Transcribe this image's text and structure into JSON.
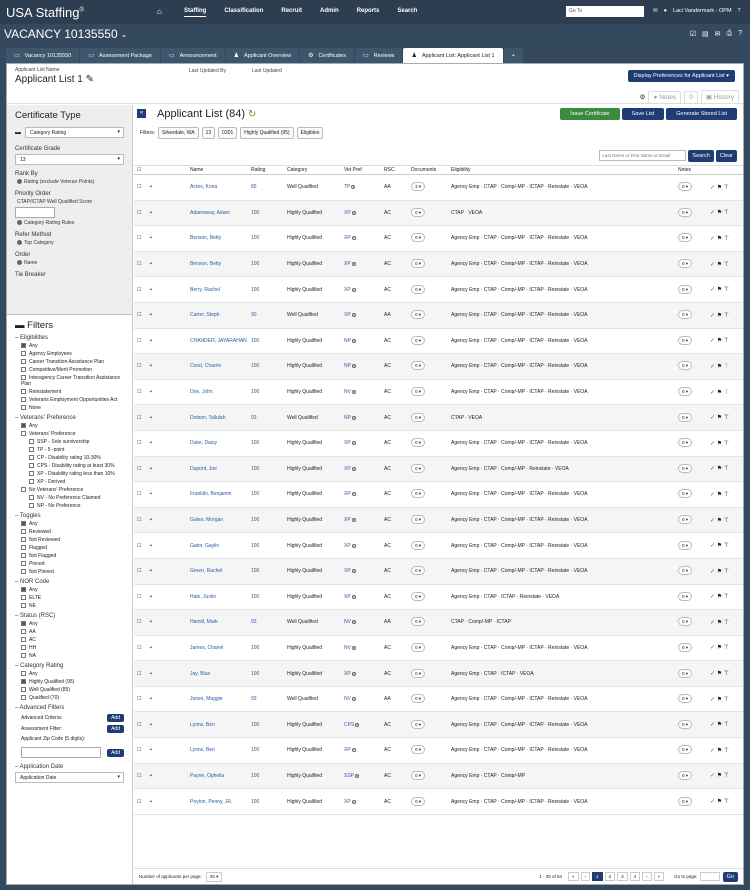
{
  "app": {
    "logo": "USA Staffing",
    "logo_mark": "®",
    "nav": [
      "Staffing",
      "Classification",
      "Recruit",
      "Admin",
      "Reports",
      "Search"
    ],
    "goto_placeholder": "Go To",
    "user": "Laci Vandermark - OPM"
  },
  "vacancy": {
    "title": "VACANCY 10135550"
  },
  "tabs": [
    "Vacancy 10135550",
    "Assessment Package",
    "Announcement",
    "Applicant Overview",
    "Certificates",
    "Reviews",
    "Applicant List: Applicant List 1"
  ],
  "header": {
    "list_name_label": "Applicant List Name",
    "list_name": "Applicant List 1",
    "updated_by_label": "Last Updated By",
    "updated_label": "Last Updated",
    "display_button": "Display Preferences for Applicant List",
    "notes": "Notes",
    "notes_count": "0",
    "history": "History"
  },
  "cert": {
    "title": "Certificate Type",
    "type": "Category Rating",
    "grade_label": "Certificate Grade",
    "grade": "13",
    "rank_label": "Rank By",
    "rank": "Rating (exclude Veteran Points)",
    "priority_label": "Priority Order",
    "ctap_label": "CTAP/ICTAP Well Qualified Score",
    "rules": "Category Rating Rules",
    "refer_label": "Refer Method",
    "refer": "Top Category",
    "order_label": "Order",
    "order": "Name",
    "tie_label": "Tie Breaker"
  },
  "filters": {
    "title": "Filters",
    "elig_title": "Eligibilities",
    "elig": [
      "Any",
      "Agency Employees",
      "Career Transition Assistance Plan",
      "Competitive/Merit Promotion",
      "Interagency Career Transition Assistance Plan",
      "Reinstatement",
      "Veterans Employment Opportunities Act",
      "None"
    ],
    "vet_title": "Veterans' Preference",
    "vet": [
      "Any",
      "Veterans' Preference"
    ],
    "vet_sub": [
      "SSP - Sole survivorship",
      "TP - 5 -point",
      "CP - Disability rating 10-30%",
      "CPS - Disability rating at least 30%",
      "XP - Disability rating less than 10%",
      "XP - Derived"
    ],
    "novet": "No Veterans' Preference",
    "novet_sub": [
      "NV - No Preference Claimed",
      "NP - No Preference"
    ],
    "tog_title": "Toggles",
    "tog": [
      "Any",
      "Reviewed",
      "Not Reviewed",
      "Flagged",
      "Not Flagged",
      "Pinned",
      "Not Pinned"
    ],
    "nor_title": "NOR Code",
    "nor": [
      "Any",
      "ELTE",
      "NE"
    ],
    "rsc_title": "Status (RSC)",
    "rsc": [
      "Any",
      "AA",
      "AC",
      "HH",
      "NA"
    ],
    "cat_title": "Category Rating",
    "cat": [
      "Any",
      "Highly Qualified (95)",
      "Well Qualified (85)",
      "Qualified (70)"
    ],
    "adv_title": "Advanced Filters",
    "adv": [
      "Advanced Criteria:",
      "Assessment Filter:",
      "Applicant Zip Code (5 digits):"
    ],
    "add": "Add",
    "app_date_title": "Application Date",
    "app_date": "Application Date"
  },
  "list": {
    "title": "Applicant List (84)",
    "issue": "Issue Certificate",
    "save": "Save List",
    "gen": "Generate Stored List",
    "filters_label": "Filters:",
    "chips": [
      "Silverdale, WA",
      "13",
      "0201",
      "Highly Qualified (95)",
      "Eligibles"
    ],
    "search_placeholder": "Last Name or First Name or Email",
    "search_btn": "Search",
    "clear_btn": "Clear",
    "headers": [
      "Name",
      "Rating",
      "Category",
      "Vet Pref",
      "RSC",
      "Documents",
      "Eligibility",
      "Notes"
    ],
    "rows": [
      {
        "name": "Acres, Kona",
        "rating": "85",
        "cat": "Well Qualified",
        "vet": "TP",
        "rsc": "AA",
        "docs": "3",
        "elig": "Agency Emp · CTAP · Comp/-MP · ICTAP · Reinstate · VEOA"
      },
      {
        "name": "Adamsway, Adam",
        "rating": "100",
        "cat": "Highly Qualified",
        "vet": "XP",
        "rsc": "AC",
        "docs": "0",
        "elig": "CTAP · VEOA"
      },
      {
        "name": "Benson, Betty",
        "rating": "100",
        "cat": "Highly Qualified",
        "vet": "XP",
        "rsc": "AC",
        "docs": "0",
        "elig": "Agency Emp · CTAP · Comp/-MP · ICTAP · Reinstate · VEOA"
      },
      {
        "name": "Benson, Betty",
        "rating": "100",
        "cat": "Highly Qualified",
        "vet": "XP",
        "rsc": "AC",
        "docs": "0",
        "elig": "Agency Emp · CTAP · Comp/-MP · ICTAP · Reinstate · VEOA"
      },
      {
        "name": "Berry, Rachel",
        "rating": "100",
        "cat": "Highly Qualified",
        "vet": "XP",
        "rsc": "AC",
        "docs": "0",
        "elig": "Agency Emp · CTAP · Comp/-MP · ICTAP · Reinstate · VEOA"
      },
      {
        "name": "Carter, Steph",
        "rating": "90",
        "cat": "Well Qualified",
        "vet": "XP",
        "rsc": "AA",
        "docs": "0",
        "elig": "Agency Emp · CTAP · Comp/-MP · ICTAP · Reinstate · VEOA"
      },
      {
        "name": "CHANDER, JAYARAHAN",
        "rating": "100",
        "cat": "Highly Qualified",
        "vet": "NP",
        "rsc": "AC",
        "docs": "0",
        "elig": "Agency Emp · CTAP · Comp/-MP · ICTAP · Reinstate · VEOA"
      },
      {
        "name": "Crest, Charrie",
        "rating": "100",
        "cat": "Highly Qualified",
        "vet": "NP",
        "rsc": "AC",
        "docs": "0",
        "elig": "Agency Emp · CTAP · Comp/-MP · ICTAP · Reinstate · VEOA"
      },
      {
        "name": "Doe, John",
        "rating": "100",
        "cat": "Highly Qualified",
        "vet": "NV",
        "rsc": "AC",
        "docs": "0",
        "elig": "Agency Emp · CTAP · Comp/-MP · ICTAP · Reinstate · VEOA"
      },
      {
        "name": "Dotson, Tallulah",
        "rating": "93",
        "cat": "Well Qualified",
        "vet": "NP",
        "rsc": "AC",
        "docs": "0",
        "elig": "CTAP · VEOA"
      },
      {
        "name": "Duke, Daisy",
        "rating": "100",
        "cat": "Highly Qualified",
        "vet": "XP",
        "rsc": "AC",
        "docs": "0",
        "elig": "Agency Emp · CTAP · Comp/-MP · ICTAP · Reinstate · VEOA"
      },
      {
        "name": "Dupont, Joe",
        "rating": "100",
        "cat": "Highly Qualified",
        "vet": "XP",
        "rsc": "AC",
        "docs": "0",
        "elig": "Agency Emp · CTAP · Comp/-MP · Reinstate · VEOA"
      },
      {
        "name": "Franklin, Benjamin",
        "rating": "100",
        "cat": "Highly Qualified",
        "vet": "XP",
        "rsc": "AC",
        "docs": "0",
        "elig": "Agency Emp · CTAP · Comp/-MP · ICTAP · Reinstate · VEOA"
      },
      {
        "name": "Gates, Morgan",
        "rating": "100",
        "cat": "Highly Qualified",
        "vet": "XP",
        "rsc": "AC",
        "docs": "0",
        "elig": "Agency Emp · CTAP · Comp/-MP · ICTAP · Reinstate · VEOA"
      },
      {
        "name": "Gator, Gaylin",
        "rating": "100",
        "cat": "Highly Qualified",
        "vet": "XP",
        "rsc": "AC",
        "docs": "0",
        "elig": "Agency Emp · CTAP · Comp/-MP · ICTAP · Reinstate · VEOA"
      },
      {
        "name": "Green, Rachel",
        "rating": "100",
        "cat": "Highly Qualified",
        "vet": "XP",
        "rsc": "AC",
        "docs": "0",
        "elig": "Agency Emp · CTAP · Comp/-MP · ICTAP · Reinstate · VEOA"
      },
      {
        "name": "Hale, Justin",
        "rating": "100",
        "cat": "Highly Qualified",
        "vet": "XP",
        "rsc": "AC",
        "docs": "0",
        "elig": "Agency Emp · CTAP · ICTAP · Reinstate · VEOA"
      },
      {
        "name": "Hamill, Mark",
        "rating": "93",
        "cat": "Well Qualified",
        "vet": "NV",
        "rsc": "AA",
        "docs": "0",
        "elig": "CTAP · Comp/-MP · ICTAP"
      },
      {
        "name": "James, Chanel",
        "rating": "100",
        "cat": "Highly Qualified",
        "vet": "NV",
        "rsc": "AC",
        "docs": "0",
        "elig": "Agency Emp · CTAP · Comp/-MP · ICTAP · Reinstate · VEOA"
      },
      {
        "name": "Jay, Blue",
        "rating": "100",
        "cat": "Highly Qualified",
        "vet": "XP",
        "rsc": "AC",
        "docs": "0",
        "elig": "Agency Emp · CTAP · ICTAP · VEOA"
      },
      {
        "name": "Jones, Maggie",
        "rating": "93",
        "cat": "Well Qualified",
        "vet": "NV",
        "rsc": "AA",
        "docs": "0",
        "elig": "Agency Emp · CTAP · Comp/-MP · ICTAP · Reinstate · VEOA"
      },
      {
        "name": "Lyons, Ben",
        "rating": "100",
        "cat": "Highly Qualified",
        "vet": "CPS",
        "rsc": "AC",
        "docs": "0",
        "elig": "Agency Emp · CTAP · Comp/-MP · ICTAP · Reinstate · VEOA"
      },
      {
        "name": "Lyons, Ben",
        "rating": "100",
        "cat": "Highly Qualified",
        "vet": "XP",
        "rsc": "AC",
        "docs": "0",
        "elig": "Agency Emp · CTAP · Comp/-MP · ICTAP · Reinstate · VEOA"
      },
      {
        "name": "Payne, Ophelia",
        "rating": "100",
        "cat": "Highly Qualified",
        "vet": "SSP",
        "rsc": "AC",
        "docs": "0",
        "elig": "Agency Emp · CTAP · Comp/-MP"
      },
      {
        "name": "Peyton, Penny, JR.",
        "rating": "100",
        "cat": "Highly Qualified",
        "vet": "XP",
        "rsc": "AC",
        "docs": "0",
        "elig": "Agency Emp · CTAP · Comp/-MP · ICTAP · Reinstate · VEOA"
      }
    ],
    "per_page_label": "Number of applicants per page:",
    "per_page": "25",
    "range": "1 - 25 of 84",
    "pages": [
      "1",
      "2",
      "3",
      "4"
    ],
    "goto_label": "Go to page:",
    "go": "Go"
  }
}
